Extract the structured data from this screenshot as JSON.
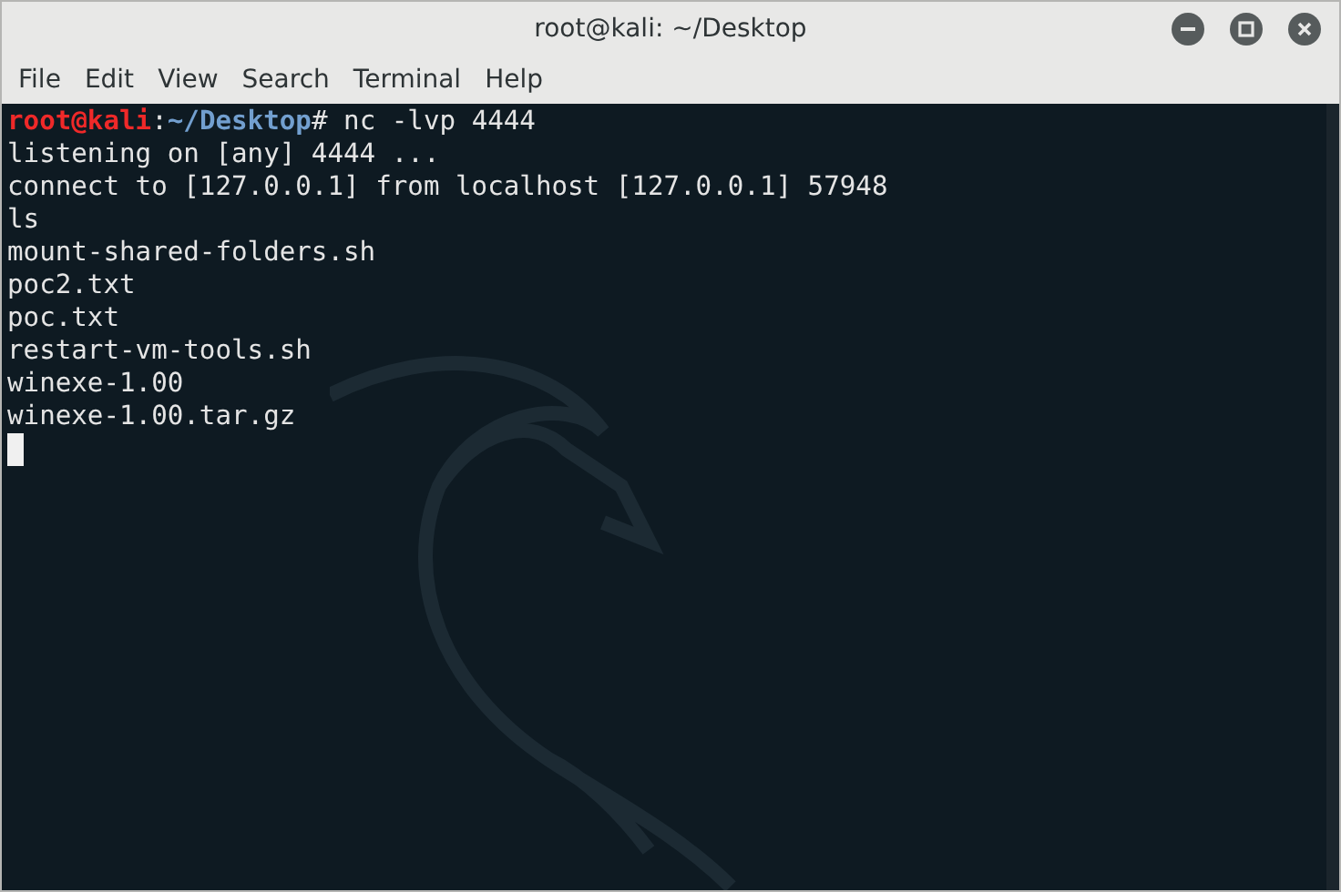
{
  "window": {
    "title": "root@kali: ~/Desktop"
  },
  "menu": [
    "File",
    "Edit",
    "View",
    "Search",
    "Terminal",
    "Help"
  ],
  "terminal": {
    "lines": [
      {
        "kind": "prompt",
        "user_host": "root@kali",
        "separator": ":",
        "path": "~/Desktop",
        "symbol": "#",
        "command": " nc -lvp 4444"
      },
      {
        "kind": "output",
        "text": "listening on [any] 4444 ..."
      },
      {
        "kind": "output",
        "text": "connect to [127.0.0.1] from localhost [127.0.0.1] 57948"
      },
      {
        "kind": "output",
        "text": "ls"
      },
      {
        "kind": "output",
        "text": "mount-shared-folders.sh"
      },
      {
        "kind": "output",
        "text": "poc2.txt"
      },
      {
        "kind": "output",
        "text": "poc.txt"
      },
      {
        "kind": "output",
        "text": "restart-vm-tools.sh"
      },
      {
        "kind": "output",
        "text": "winexe-1.00"
      },
      {
        "kind": "output",
        "text": "winexe-1.00.tar.gz"
      },
      {
        "kind": "cursor"
      }
    ]
  }
}
